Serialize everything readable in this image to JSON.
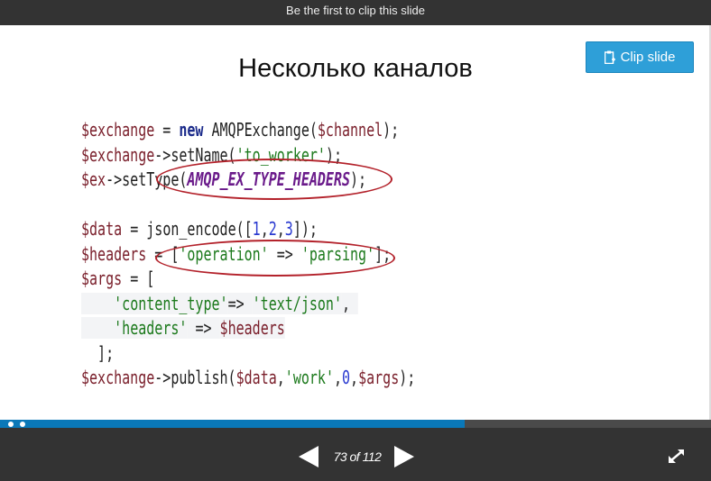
{
  "topbar": {
    "text": "Be the first to clip this slide"
  },
  "clip_button": {
    "label": "Clip slide",
    "icon": "clip-icon",
    "color": "#2e9fd8"
  },
  "slide": {
    "title": "Несколько каналов",
    "code_lines": [
      [
        [
          "$exchange",
          "v"
        ],
        [
          " = ",
          "t"
        ],
        [
          "new",
          "k"
        ],
        [
          " AMQPExchange(",
          "t"
        ],
        [
          "$channel",
          "v"
        ],
        [
          ");",
          "t"
        ]
      ],
      [
        [
          "$exchange",
          "v"
        ],
        [
          "->setName(",
          "t"
        ],
        [
          "'to_worker'",
          "s"
        ],
        [
          ");",
          "t"
        ]
      ],
      [
        [
          "$ex",
          "v"
        ],
        [
          "->setType(",
          "t"
        ],
        [
          "AMQP_EX_TYPE_HEADERS",
          "c"
        ],
        [
          ");",
          "t"
        ]
      ],
      [],
      [
        [
          "$data",
          "v"
        ],
        [
          " = json_encode([",
          "t"
        ],
        [
          "1",
          "n"
        ],
        [
          ",",
          "t"
        ],
        [
          "2",
          "n"
        ],
        [
          ",",
          "t"
        ],
        [
          "3",
          "n"
        ],
        [
          "]);",
          "t"
        ]
      ],
      [
        [
          "$headers",
          "v"
        ],
        [
          " = [",
          "t"
        ],
        [
          "'operation'",
          "s"
        ],
        [
          " => ",
          "t"
        ],
        [
          "'parsing'",
          "s"
        ],
        [
          "];",
          "t"
        ]
      ],
      [
        [
          "$args",
          "v"
        ],
        [
          " = [",
          "t"
        ]
      ],
      [
        [
          "    ",
          "t"
        ],
        [
          "'content_type'",
          "s"
        ],
        [
          "=> ",
          "t"
        ],
        [
          "'text/json'",
          "s"
        ],
        [
          ", ",
          "t"
        ]
      ],
      [
        [
          "    ",
          "t"
        ],
        [
          "'headers'",
          "s"
        ],
        [
          " => ",
          "t"
        ],
        [
          "$headers",
          "v"
        ]
      ],
      [
        [
          "  ];",
          "t"
        ]
      ],
      [
        [
          "$exchange",
          "v"
        ],
        [
          "->publish(",
          "t"
        ],
        [
          "$data",
          "v"
        ],
        [
          ",",
          "t"
        ],
        [
          "'work'",
          "s"
        ],
        [
          ",",
          "t"
        ],
        [
          "0",
          "n"
        ],
        [
          ",",
          "t"
        ],
        [
          "$args",
          "v"
        ],
        [
          ");",
          "t"
        ]
      ]
    ],
    "annotation_color": "#b3212a"
  },
  "progress": {
    "percent": 65.3,
    "color": "#0a78b8"
  },
  "nav": {
    "counter": "73 of 112",
    "prev_icon": "triangle-left-icon",
    "next_icon": "triangle-right-icon",
    "fullscreen_icon": "expand-arrows-icon"
  }
}
